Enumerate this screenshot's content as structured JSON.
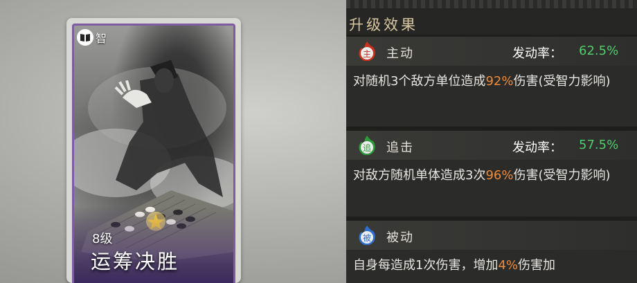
{
  "card": {
    "type_label": "智",
    "level": "8级",
    "name": "运筹决胜"
  },
  "panel": {
    "title": "升级效果",
    "sections": [
      {
        "icon_char": "主",
        "type_label": "主动",
        "rate_label": "发动率：",
        "rate_value": "62.5%",
        "desc_before": "对随机3个敌方单位造成",
        "desc_highlight": "92%",
        "desc_after": "伤害(受智力影响)"
      },
      {
        "icon_char": "追",
        "type_label": "追击",
        "rate_label": "发动率：",
        "rate_value": "57.5%",
        "desc_before": "对敌方随机单体造成3次",
        "desc_highlight": "96%",
        "desc_after": "伤害(受智力影响)"
      },
      {
        "icon_char": "被",
        "type_label": "被动",
        "desc_before": "自身每造成1次伤害，增加",
        "desc_highlight": "4%",
        "desc_after": "伤害加"
      }
    ]
  },
  "colors": {
    "rate_green": "#4fce6a",
    "highlight_orange": "#ef8b3a",
    "card_border_purple": "#7e5ca3",
    "active_icon_red": "#c8321e",
    "chase_icon_green": "#2f9a3c",
    "passive_icon_blue": "#2f6fcf"
  },
  "icons": {
    "card_type": "book-icon",
    "section_0": "flame-badge-red-icon",
    "section_1": "flame-badge-green-icon",
    "section_2": "flame-badge-blue-icon"
  }
}
